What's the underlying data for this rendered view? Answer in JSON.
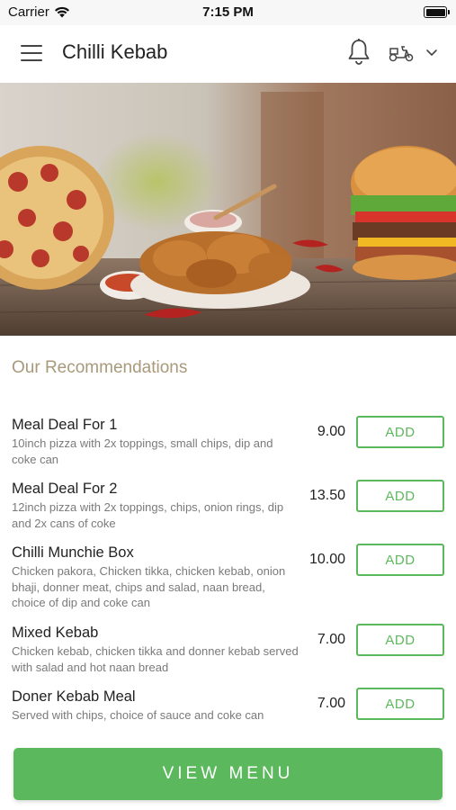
{
  "status_bar": {
    "carrier": "Carrier",
    "time": "7:15 PM",
    "wifi_icon": "wifi-icon",
    "battery_icon": "battery-icon"
  },
  "nav": {
    "title": "Chilli Kebab",
    "menu_icon": "hamburger-menu-icon",
    "bell_icon": "bell-icon",
    "delivery_icon": "scooter-icon",
    "dropdown_icon": "chevron-down-icon"
  },
  "hero": {
    "image": "food-banner-pizza-chicken-burger"
  },
  "recommendations": {
    "title": "Our Recommendations",
    "items": [
      {
        "name": "Meal Deal For 1",
        "description": "10inch pizza with 2x toppings, small chips, dip and coke can",
        "price": "9.00",
        "button": "ADD"
      },
      {
        "name": "Meal Deal For 2",
        "description": "12inch pizza with 2x toppings, chips, onion rings, dip and 2x cans of coke",
        "price": "13.50",
        "button": "ADD"
      },
      {
        "name": "Chilli Munchie Box",
        "description": "Chicken pakora, Chicken tikka, chicken kebab, onion bhaji, donner meat, chips and salad, naan bread, choice of dip and coke can",
        "price": "10.00",
        "button": "ADD"
      },
      {
        "name": "Mixed Kebab",
        "description": "Chicken kebab, chicken tikka and donner kebab served with salad and hot naan bread",
        "price": "7.00",
        "button": "ADD"
      },
      {
        "name": "Doner Kebab Meal",
        "description": "Served with chips, choice of sauce and coke can",
        "price": "7.00",
        "button": "ADD"
      }
    ]
  },
  "footer": {
    "view_menu_label": "VIEW MENU"
  },
  "colors": {
    "accent_green": "#5cb85c",
    "section_title": "#a8997a",
    "description_text": "#7a7a7a"
  }
}
